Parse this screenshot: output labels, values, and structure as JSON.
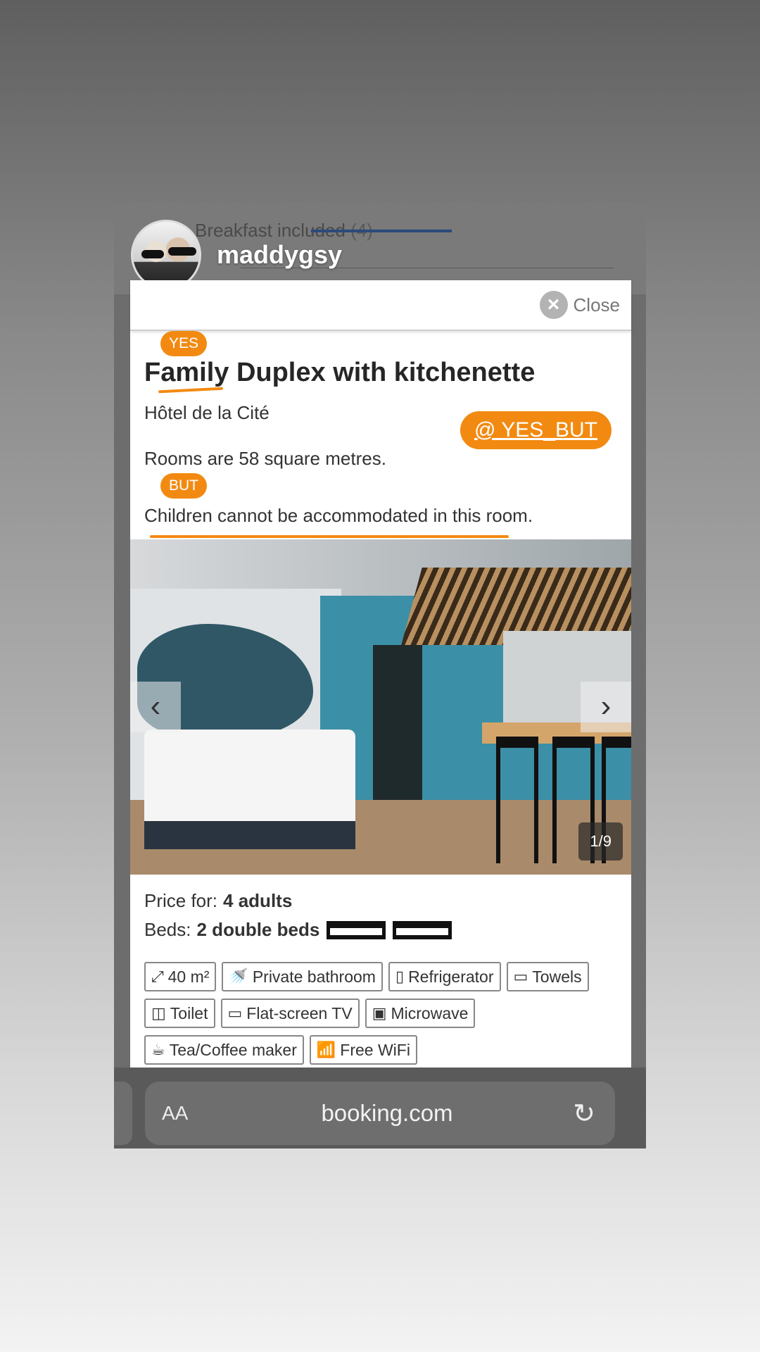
{
  "story": {
    "username": "maddygsy",
    "background_text": "Breakfast included",
    "background_count": "(4)"
  },
  "modal": {
    "close_label": "Close",
    "room_title": "Family Duplex with kitchenette",
    "hotel_name": "Hôtel de la Cité",
    "room_size": "Rooms are 58 square metres.",
    "restriction": "Children cannot be accommodated in this room."
  },
  "annotations": {
    "yes_tag": "YES",
    "but_tag": "BUT",
    "yes_but_badge": "@ YES_BUT",
    "accent_color": "#f28a12"
  },
  "gallery": {
    "counter": "1/9",
    "prev_icon": "chevron-left-icon",
    "next_icon": "chevron-right-icon"
  },
  "details": {
    "price_label": "Price for:",
    "price_value": "4 adults",
    "beds_label": "Beds:",
    "beds_value": "2 double beds",
    "facilities": [
      {
        "icon": "⤢",
        "label": "40 m²"
      },
      {
        "icon": "🚿",
        "label": "Private bathroom"
      },
      {
        "icon": "▯",
        "label": "Refrigerator"
      },
      {
        "icon": "▭",
        "label": "Towels"
      },
      {
        "icon": "◫",
        "label": "Toilet"
      },
      {
        "icon": "▭",
        "label": "Flat-screen TV"
      },
      {
        "icon": "▣",
        "label": "Microwave"
      },
      {
        "icon": "☕",
        "label": "Tea/Coffee maker"
      },
      {
        "icon": "📶",
        "label": "Free WiFi"
      }
    ]
  },
  "browser": {
    "text_size_label": "AA",
    "url": "booking.com",
    "reload_icon": "reload-icon"
  }
}
